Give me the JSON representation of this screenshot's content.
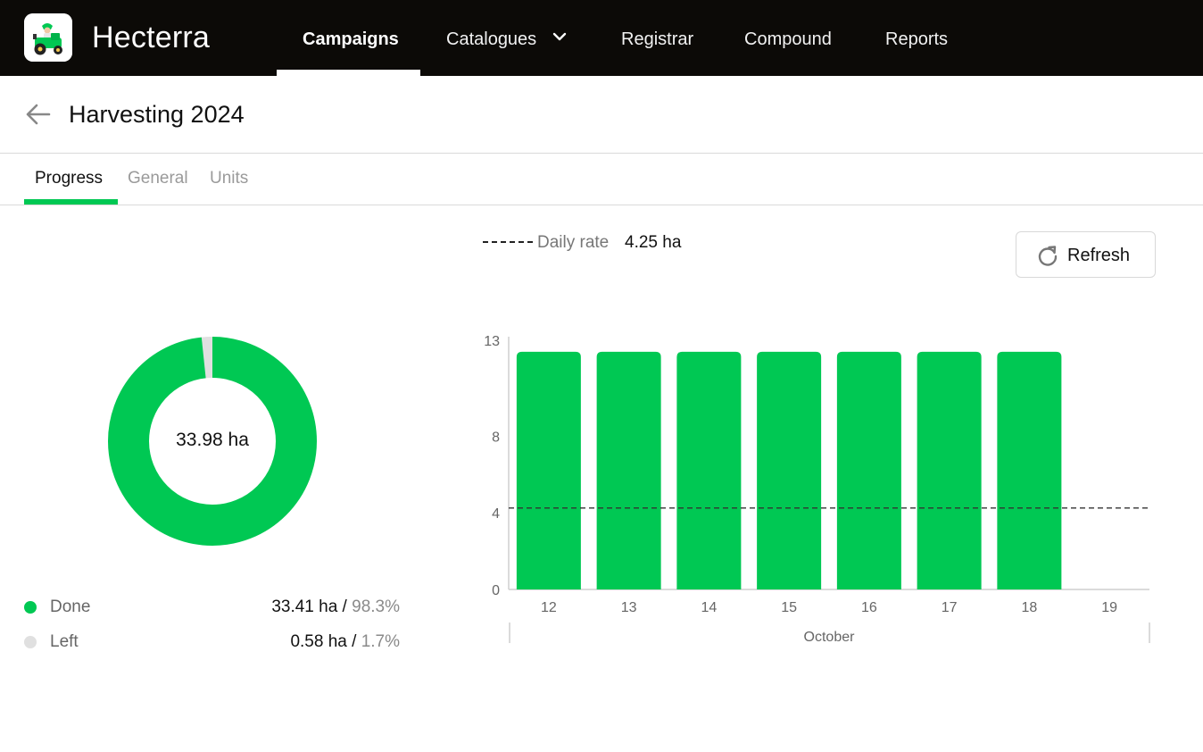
{
  "app": {
    "name": "Hecterra",
    "logo_icon": "tractor-logo-icon"
  },
  "nav": {
    "items": [
      {
        "label": "Campaigns",
        "active": true
      },
      {
        "label": "Catalogues",
        "dropdown": true
      },
      {
        "label": "Registrar"
      },
      {
        "label": "Compound"
      },
      {
        "label": "Reports"
      }
    ]
  },
  "header": {
    "title": "Harvesting 2024",
    "back_icon": "arrow-left-icon"
  },
  "tabs": [
    {
      "label": "Progress",
      "active": true
    },
    {
      "label": "General"
    },
    {
      "label": "Units"
    }
  ],
  "daily_rate": {
    "label": "Daily rate",
    "value": "4.25 ha"
  },
  "refresh": {
    "label": "Refresh",
    "icon": "refresh-icon"
  },
  "summary": {
    "total": "33.98 ha",
    "done": {
      "label": "Done",
      "value": "33.41 ha",
      "separator": " / ",
      "percent": "98.3%",
      "fraction": 0.983
    },
    "left": {
      "label": "Left",
      "value": "0.58 ha",
      "separator": " / ",
      "percent": "1.7%",
      "fraction": 0.017
    }
  },
  "colors": {
    "accent": "#00c853",
    "remaining": "#e0e0e0",
    "topbar": "#0c0a07"
  },
  "chart_data": {
    "type": "bar",
    "categories": [
      "12",
      "13",
      "14",
      "15",
      "16",
      "17",
      "18",
      "19"
    ],
    "values": [
      12.4,
      12.4,
      12.4,
      12.4,
      12.4,
      12.4,
      12.4,
      null
    ],
    "xlabel": "October",
    "ylabel": "",
    "yticks": [
      0,
      4,
      8,
      13
    ],
    "ylim": [
      0,
      13
    ],
    "reference_line": {
      "value": 4.25,
      "style": "dashed"
    },
    "grid": false
  }
}
